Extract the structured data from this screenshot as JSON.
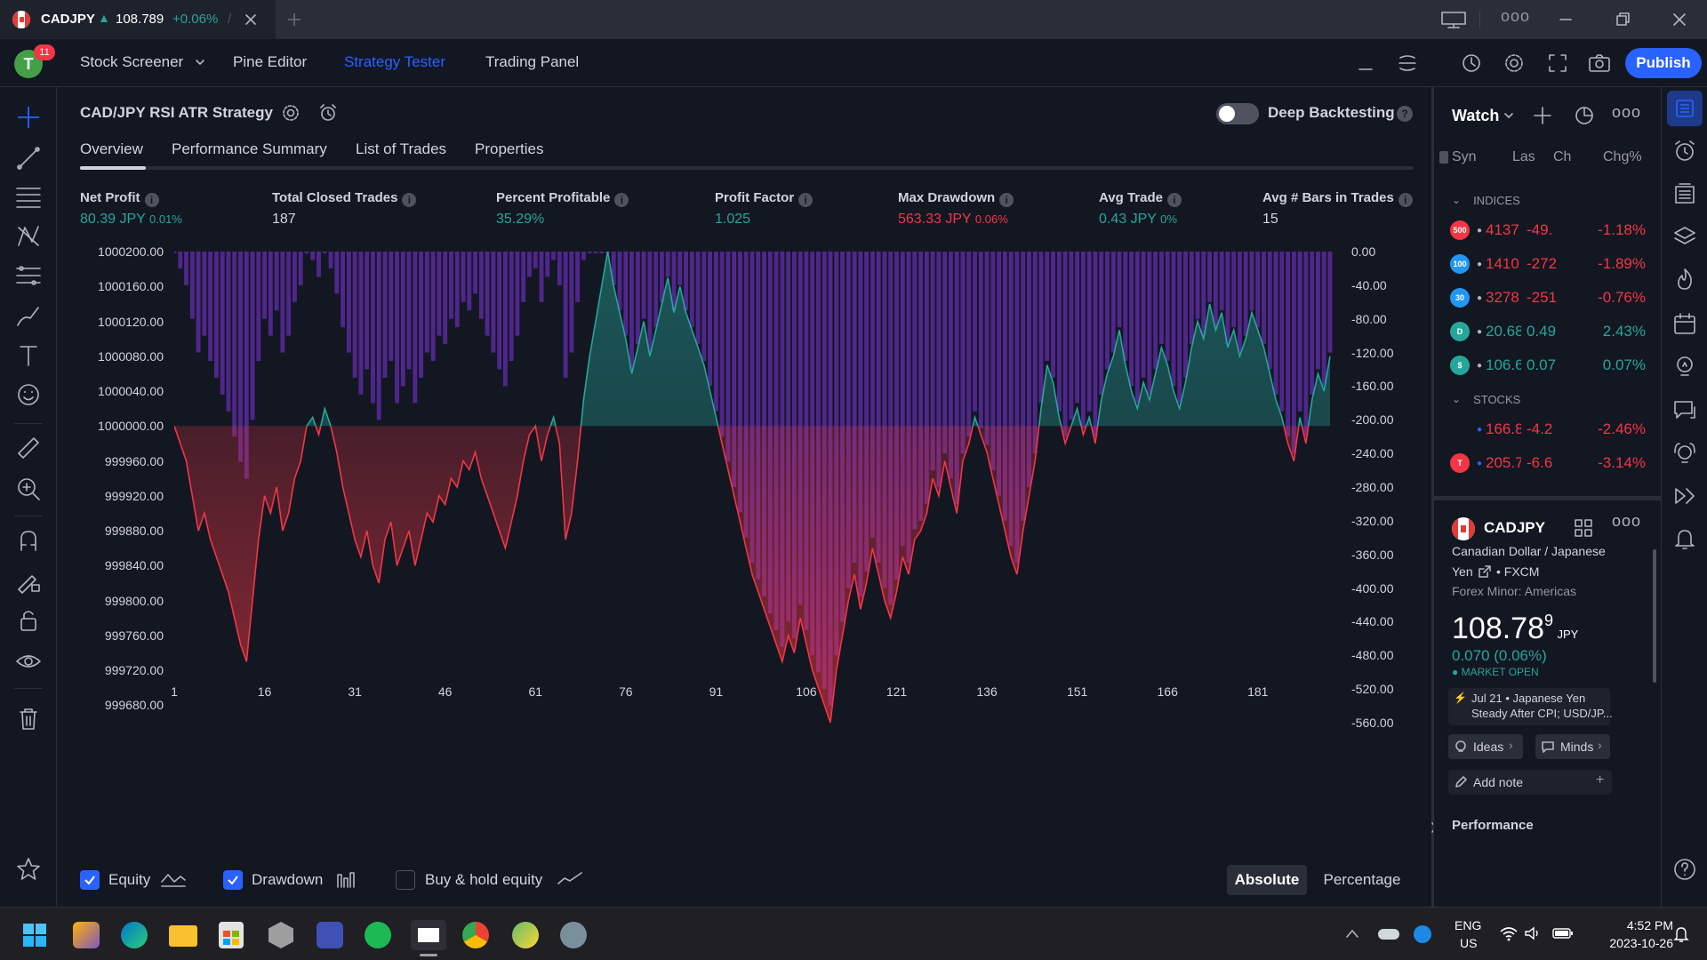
{
  "browser": {
    "tab_symbol": "CADJPY",
    "tab_price": "108.789",
    "tab_change": "+0.06%",
    "tab_sep": "/"
  },
  "topbar": {
    "notifications": "11",
    "avatar_letter": "T",
    "stock_screener": "Stock Screener",
    "pine_editor": "Pine Editor",
    "strategy_tester": "Strategy Tester",
    "trading_panel": "Trading Panel",
    "publish": "Publish"
  },
  "strategy": {
    "name": "CAD/JPY RSI ATR Strategy",
    "deep_backtesting": "Deep Backtesting",
    "deep_backtesting_on": false,
    "tabs": [
      "Overview",
      "Performance Summary",
      "List of Trades",
      "Properties"
    ],
    "active_tab": "Overview"
  },
  "metrics": [
    {
      "label": "Net Profit",
      "value": "80.39 JPY",
      "sub": "0.01%",
      "color": "green"
    },
    {
      "label": "Total Closed Trades",
      "value": "187",
      "sub": "",
      "color": "white"
    },
    {
      "label": "Percent Profitable",
      "value": "35.29%",
      "sub": "",
      "color": "green"
    },
    {
      "label": "Profit Factor",
      "value": "1.025",
      "sub": "",
      "color": "green"
    },
    {
      "label": "Max Drawdown",
      "value": "563.33 JPY",
      "sub": "0.06%",
      "color": "red"
    },
    {
      "label": "Avg Trade",
      "value": "0.43 JPY",
      "sub": "0%",
      "color": "green"
    },
    {
      "label": "Avg # Bars in Trades",
      "value": "15",
      "sub": "",
      "color": "white"
    }
  ],
  "chart_data": {
    "type": "area",
    "left_axis_ticks": [
      "1000200.00",
      "1000160.00",
      "1000120.00",
      "1000080.00",
      "1000040.00",
      "1000000.00",
      "999960.00",
      "999920.00",
      "999880.00",
      "999840.00",
      "999800.00",
      "999760.00",
      "999720.00",
      "999680.00"
    ],
    "right_axis_ticks": [
      "0.00",
      "-40.00",
      "-80.00",
      "-120.00",
      "-160.00",
      "-200.00",
      "-240.00",
      "-280.00",
      "-320.00",
      "-360.00",
      "-400.00",
      "-440.00",
      "-480.00",
      "-520.00",
      "-560.00"
    ],
    "x_ticks": [
      "1",
      "16",
      "31",
      "46",
      "61",
      "76",
      "91",
      "106",
      "121",
      "136",
      "151",
      "166",
      "181"
    ],
    "ylim": [
      999660,
      1000200
    ],
    "baseline": 1000000,
    "series": [
      {
        "name": "Equity",
        "values": [
          1000000,
          999980,
          999960,
          999920,
          999880,
          999900,
          999870,
          999850,
          999830,
          999810,
          999780,
          999750,
          999730,
          999800,
          999870,
          999920,
          999900,
          999930,
          999880,
          999900,
          999940,
          999960,
          1000000,
          1000010,
          999990,
          1000020,
          1000000,
          999970,
          999930,
          999900,
          999870,
          999850,
          999880,
          999840,
          999820,
          999870,
          999890,
          999840,
          999860,
          999880,
          999840,
          999870,
          999900,
          999890,
          999920,
          999910,
          999940,
          999930,
          999960,
          999950,
          999970,
          999940,
          999920,
          999900,
          999880,
          999860,
          999890,
          999920,
          999960,
          999990,
          1000000,
          999960,
          999990,
          1000010,
          999980,
          999870,
          999900,
          999960,
          1000030,
          1000080,
          1000120,
          1000160,
          1000200,
          1000160,
          1000130,
          1000100,
          1000060,
          1000090,
          1000120,
          1000080,
          1000110,
          1000140,
          1000170,
          1000130,
          1000160,
          1000130,
          1000110,
          1000090,
          1000070,
          1000040,
          1000010,
          999980,
          999950,
          999920,
          999890,
          999860,
          999830,
          999810,
          999790,
          999770,
          999750,
          999730,
          999760,
          999740,
          999780,
          999750,
          999720,
          999700,
          999680,
          999660,
          999720,
          999760,
          999800,
          999830,
          999790,
          999820,
          999860,
          999830,
          999800,
          999780,
          999810,
          999850,
          999830,
          999870,
          999880,
          999900,
          999940,
          999920,
          999960,
          999930,
          999900,
          999960,
          999980,
          1000010,
          999990,
          999970,
          999940,
          999910,
          999880,
          999850,
          999830,
          999880,
          999920,
          999960,
          1000020,
          1000070,
          1000050,
          1000010,
          999980,
          1000000,
          1000020,
          999990,
          1000010,
          999980,
          1000030,
          1000060,
          1000080,
          1000110,
          1000070,
          1000040,
          1000020,
          1000050,
          1000030,
          1000060,
          1000090,
          1000070,
          1000040,
          1000020,
          1000050,
          1000090,
          1000120,
          1000100,
          1000140,
          1000110,
          1000130,
          1000090,
          1000110,
          1000080,
          1000100,
          1000130,
          1000110,
          1000090,
          1000060,
          1000030,
          1000010,
          999980,
          999960,
          1000010,
          999980,
          1000030,
          1000060,
          1000040,
          1000080
        ]
      },
      {
        "name": "Drawdown",
        "values": [
          0,
          -20,
          -40,
          -80,
          -120,
          -100,
          -130,
          -150,
          -170,
          -190,
          -220,
          -250,
          -270,
          -200,
          -130,
          -80,
          -100,
          -70,
          -120,
          -100,
          -60,
          -40,
          0,
          -10,
          -30,
          0,
          -20,
          -50,
          -90,
          -120,
          -150,
          -170,
          -140,
          -180,
          -200,
          -150,
          -130,
          -180,
          -160,
          -140,
          -180,
          -150,
          -120,
          -130,
          -100,
          -110,
          -80,
          -90,
          -60,
          -70,
          -50,
          -80,
          -100,
          -120,
          -140,
          -160,
          -130,
          -100,
          -60,
          -30,
          -20,
          -60,
          -30,
          -10,
          -40,
          -150,
          -120,
          -60,
          -10,
          0,
          0,
          0,
          0,
          -40,
          -70,
          -100,
          -140,
          -110,
          -80,
          -120,
          -90,
          -60,
          -30,
          -70,
          -40,
          -70,
          -90,
          -110,
          -130,
          -160,
          -190,
          -220,
          -250,
          -280,
          -310,
          -340,
          -370,
          -390,
          -410,
          -430,
          -450,
          -470,
          -440,
          -460,
          -420,
          -450,
          -480,
          -500,
          -520,
          -540,
          -480,
          -440,
          -400,
          -370,
          -410,
          -380,
          -340,
          -370,
          -400,
          -420,
          -390,
          -350,
          -370,
          -330,
          -320,
          -300,
          -260,
          -280,
          -240,
          -270,
          -300,
          -240,
          -220,
          -190,
          -210,
          -230,
          -260,
          -290,
          -320,
          -350,
          -370,
          -320,
          -280,
          -240,
          -180,
          -130,
          -150,
          -190,
          -220,
          -200,
          -180,
          -210,
          -190,
          -220,
          -170,
          -140,
          -120,
          -90,
          -130,
          -160,
          -180,
          -150,
          -170,
          -140,
          -110,
          -130,
          -160,
          -180,
          -150,
          -110,
          -80,
          -100,
          -60,
          -90,
          -70,
          -110,
          -90,
          -120,
          -100,
          -70,
          -90,
          -110,
          -140,
          -170,
          -190,
          -220,
          -240,
          -190,
          -220,
          -170,
          -140,
          -160,
          -120
        ]
      }
    ]
  },
  "legend": {
    "equity": "Equity",
    "equity_checked": true,
    "drawdown": "Drawdown",
    "drawdown_checked": true,
    "buyhold": "Buy & hold equity",
    "buyhold_checked": false,
    "absolute": "Absolute",
    "percentage": "Percentage",
    "selected_mode": "Absolute"
  },
  "watchlist": {
    "title": "Watch",
    "columns": [
      "Syn",
      "Las",
      "Ch",
      "Chg%"
    ],
    "sections": [
      {
        "name": "INDICES",
        "rows": [
          {
            "icon_text": "500",
            "icon_color": "#f23645",
            "last": "4137",
            "chg": "-49.",
            "chgp": "-1.18%",
            "color": "red"
          },
          {
            "icon_text": "100",
            "icon_color": "#2196f3",
            "last": "1410",
            "chg": "-272",
            "chgp": "-1.89%",
            "color": "red"
          },
          {
            "icon_text": "30",
            "icon_color": "#2196f3",
            "last": "3278",
            "chg": "-251",
            "chgp": "-0.76%",
            "color": "red"
          },
          {
            "icon_text": "D",
            "icon_color": "#26a69a",
            "last": "20.68",
            "chg": "0.49",
            "chgp": "2.43%",
            "color": "green"
          },
          {
            "icon_text": "$",
            "icon_color": "#26a69a",
            "last": "106.6",
            "chg": "0.07",
            "chgp": "0.07%",
            "color": "green"
          }
        ]
      },
      {
        "name": "STOCKS",
        "rows": [
          {
            "icon_text": "",
            "icon_color": "#131722",
            "last": "166.8",
            "chg": "-4.2",
            "chgp": "-2.46%",
            "color": "red"
          },
          {
            "icon_text": "T",
            "icon_color": "#f23645",
            "last": "205.7",
            "chg": "-6.6",
            "chgp": "-3.14%",
            "color": "red"
          }
        ]
      }
    ]
  },
  "details": {
    "symbol": "CADJPY",
    "name_line1": "Canadian Dollar / Japanese",
    "name_line2": "Yen",
    "exchange": "FXCM",
    "category": "Forex Minor: Americas",
    "price_main": "108.78",
    "price_sup": "9",
    "currency": "JPY",
    "change": "0.070 (0.06%)",
    "market_status": "MARKET OPEN",
    "news_date": "Jul 21",
    "news_source": "Japanese Yen",
    "news_title": "Steady After CPI; USD/JP...",
    "ideas": "Ideas",
    "minds": "Minds",
    "add_note": "Add note",
    "performance": "Performance"
  },
  "taskbar": {
    "lang1": "ENG",
    "lang2": "US",
    "time": "4:52 PM",
    "date": "2023-10-26"
  }
}
